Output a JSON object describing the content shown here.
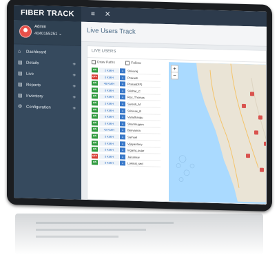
{
  "header": {
    "brand": "FIBER TRACK",
    "menu_icon": "≡",
    "fullscreen_icon": "✕"
  },
  "sidebar": {
    "user": {
      "name": "Admin",
      "id": "4040155251"
    },
    "items": [
      {
        "label": "Dashboard",
        "icon": "home-icon"
      },
      {
        "label": "Details",
        "icon": "list-icon"
      },
      {
        "label": "Live",
        "icon": "list-icon"
      },
      {
        "label": "Reports",
        "icon": "list-icon"
      },
      {
        "label": "Inventory",
        "icon": "list-icon"
      },
      {
        "label": "Configuration",
        "icon": "gear-icon"
      }
    ]
  },
  "main": {
    "page_title": "Live Users Track",
    "card_title": "LIVE USERS",
    "option_draw_paths": "Draw Paths",
    "option_follow": "Follow",
    "map_zoom_in": "+",
    "map_zoom_out": "−"
  },
  "users": [
    {
      "status": "ON",
      "speed": "2 KM/H",
      "name": "Shivaraj"
    },
    {
      "status": "OFF",
      "speed": "0 KM/H",
      "name": "Prakash"
    },
    {
      "status": "ON",
      "speed": "48 KM/H",
      "name": "Prasad(KF)"
    },
    {
      "status": "ON",
      "speed": "0 KM/H",
      "name": "Sridhar_C"
    },
    {
      "status": "ON",
      "speed": "0 KM/H",
      "name": "Roy_Thomas"
    },
    {
      "status": "ON",
      "speed": "3 KM/H",
      "name": "Suresh_M"
    },
    {
      "status": "ON",
      "speed": "0 KM/H",
      "name": "Srinivas_B"
    },
    {
      "status": "ON",
      "speed": "0 KM/H",
      "name": "Varadharaju"
    },
    {
      "status": "ON",
      "speed": "0 KM/H",
      "name": "Shanmugam"
    },
    {
      "status": "ON",
      "speed": "42 KM/H",
      "name": "Beevanna"
    },
    {
      "status": "ON",
      "speed": "0 KM/H",
      "name": "Samuel"
    },
    {
      "status": "ON",
      "speed": "0 KM/H",
      "name": "Vijayantony"
    },
    {
      "status": "ON",
      "speed": "0 KM/H",
      "name": "Ingaraj_pujar"
    },
    {
      "status": "OFF",
      "speed": "0 KM/H",
      "name": "Jaisankar"
    },
    {
      "status": "ON",
      "speed": "0 KM/H",
      "name": "Lokmal_sed"
    }
  ],
  "colors": {
    "status_on": "#2f9a3e",
    "status_off": "#d83b33",
    "map_sea": "#aadaff",
    "map_land": "#eae4d6",
    "map_marker": "#d9534f"
  }
}
